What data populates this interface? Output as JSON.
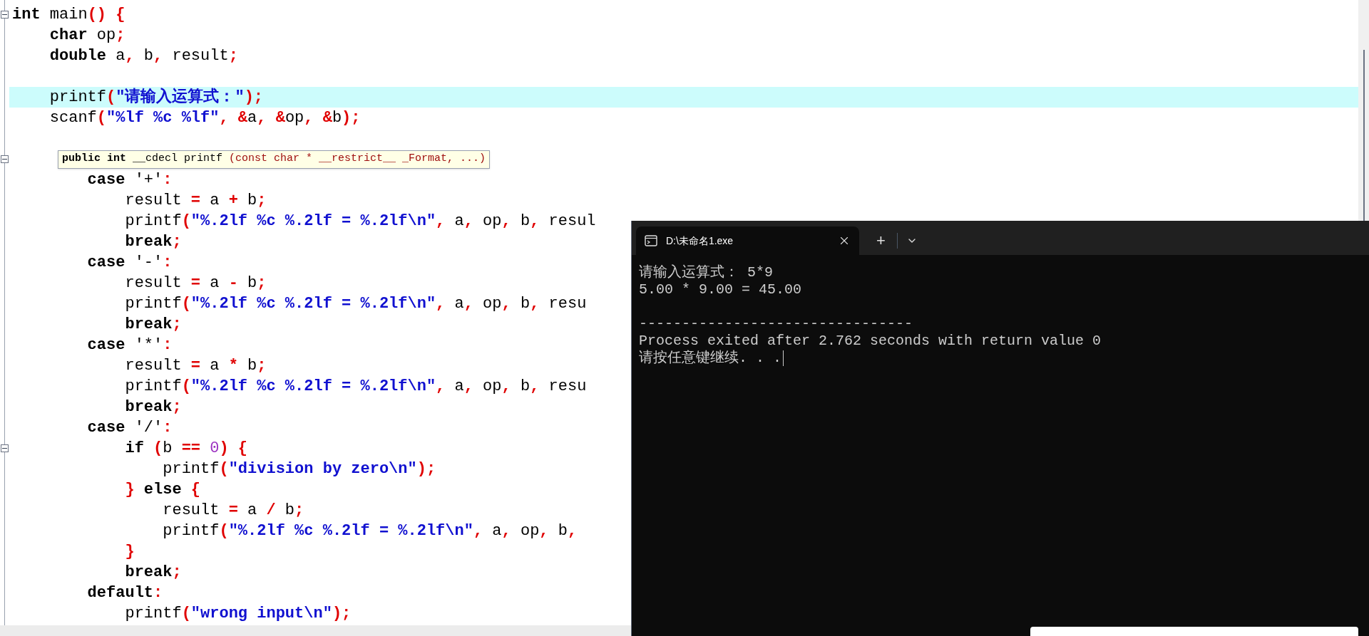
{
  "editor": {
    "lines": [
      {
        "kind": "code",
        "current": false,
        "fold": {
          "expanded": true
        },
        "tokens": [
          {
            "text": "int",
            "kind": "keyword"
          },
          {
            "text": " main",
            "kind": "plain"
          },
          {
            "text": "() {",
            "kind": "punct"
          }
        ]
      },
      {
        "kind": "code",
        "current": false,
        "tokens": [
          {
            "text": "    char",
            "kind": "keyword"
          },
          {
            "text": " op",
            "kind": "plain"
          },
          {
            "text": ";",
            "kind": "punct"
          }
        ]
      },
      {
        "kind": "code",
        "current": false,
        "tokens": [
          {
            "text": "    double",
            "kind": "keyword"
          },
          {
            "text": " a",
            "kind": "plain"
          },
          {
            "text": ",",
            "kind": "punct"
          },
          {
            "text": " b",
            "kind": "plain"
          },
          {
            "text": ",",
            "kind": "punct"
          },
          {
            "text": " result",
            "kind": "plain"
          },
          {
            "text": ";",
            "kind": "punct"
          }
        ]
      },
      {
        "kind": "blank"
      },
      {
        "kind": "code",
        "current": true,
        "tokens": [
          {
            "text": "    printf",
            "kind": "plain"
          },
          {
            "text": "(",
            "kind": "punct"
          },
          {
            "text": "\"请输入运算式：\"",
            "kind": "string"
          },
          {
            "text": ");",
            "kind": "punct"
          }
        ]
      },
      {
        "kind": "code",
        "current": false,
        "tokens": [
          {
            "text": "    scanf",
            "kind": "plain"
          },
          {
            "text": "(",
            "kind": "punct"
          },
          {
            "text": "\"%lf %c %lf\"",
            "kind": "string"
          },
          {
            "text": ",",
            "kind": "punct"
          },
          {
            "text": " &",
            "kind": "punct"
          },
          {
            "text": "a",
            "kind": "plain"
          },
          {
            "text": ",",
            "kind": "punct"
          },
          {
            "text": " &",
            "kind": "punct"
          },
          {
            "text": "op",
            "kind": "plain"
          },
          {
            "text": ",",
            "kind": "punct"
          },
          {
            "text": " &",
            "kind": "punct"
          },
          {
            "text": "b",
            "kind": "plain"
          },
          {
            "text": ");",
            "kind": "punct"
          }
        ]
      },
      {
        "kind": "blank"
      },
      {
        "kind": "tooltip",
        "fold": {
          "expanded": true
        },
        "tokens": [
          {
            "text": "public int",
            "kind": "keyword"
          },
          {
            "text": " __cdecl printf ",
            "kind": "plain"
          },
          {
            "text": "(const char * __restrict__ _Format, ...)",
            "kind": "param"
          }
        ]
      },
      {
        "kind": "code",
        "current": false,
        "tokens": [
          {
            "text": "        case",
            "kind": "keyword"
          },
          {
            "text": " '+'",
            "kind": "plain"
          },
          {
            "text": ":",
            "kind": "punct"
          }
        ]
      },
      {
        "kind": "code",
        "current": false,
        "tokens": [
          {
            "text": "            result",
            "kind": "plain"
          },
          {
            "text": " =",
            "kind": "punct"
          },
          {
            "text": " a",
            "kind": "plain"
          },
          {
            "text": " +",
            "kind": "punct"
          },
          {
            "text": " b",
            "kind": "plain"
          },
          {
            "text": ";",
            "kind": "punct"
          }
        ]
      },
      {
        "kind": "code",
        "current": false,
        "tokens": [
          {
            "text": "            printf",
            "kind": "plain"
          },
          {
            "text": "(",
            "kind": "punct"
          },
          {
            "text": "\"%.2lf %c %.2lf = %.2lf\\n\"",
            "kind": "string"
          },
          {
            "text": ",",
            "kind": "punct"
          },
          {
            "text": " a",
            "kind": "plain"
          },
          {
            "text": ",",
            "kind": "punct"
          },
          {
            "text": " op",
            "kind": "plain"
          },
          {
            "text": ",",
            "kind": "punct"
          },
          {
            "text": " b",
            "kind": "plain"
          },
          {
            "text": ",",
            "kind": "punct"
          },
          {
            "text": " resul",
            "kind": "plain"
          }
        ]
      },
      {
        "kind": "code",
        "current": false,
        "tokens": [
          {
            "text": "            break",
            "kind": "keyword"
          },
          {
            "text": ";",
            "kind": "punct"
          }
        ]
      },
      {
        "kind": "code",
        "current": false,
        "tokens": [
          {
            "text": "        case",
            "kind": "keyword"
          },
          {
            "text": " '-'",
            "kind": "plain"
          },
          {
            "text": ":",
            "kind": "punct"
          }
        ]
      },
      {
        "kind": "code",
        "current": false,
        "tokens": [
          {
            "text": "            result",
            "kind": "plain"
          },
          {
            "text": " =",
            "kind": "punct"
          },
          {
            "text": " a",
            "kind": "plain"
          },
          {
            "text": " -",
            "kind": "punct"
          },
          {
            "text": " b",
            "kind": "plain"
          },
          {
            "text": ";",
            "kind": "punct"
          }
        ]
      },
      {
        "kind": "code",
        "current": false,
        "tokens": [
          {
            "text": "            printf",
            "kind": "plain"
          },
          {
            "text": "(",
            "kind": "punct"
          },
          {
            "text": "\"%.2lf %c %.2lf = %.2lf\\n\"",
            "kind": "string"
          },
          {
            "text": ",",
            "kind": "punct"
          },
          {
            "text": " a",
            "kind": "plain"
          },
          {
            "text": ",",
            "kind": "punct"
          },
          {
            "text": " op",
            "kind": "plain"
          },
          {
            "text": ",",
            "kind": "punct"
          },
          {
            "text": " b",
            "kind": "plain"
          },
          {
            "text": ",",
            "kind": "punct"
          },
          {
            "text": " resu",
            "kind": "plain"
          }
        ]
      },
      {
        "kind": "code",
        "current": false,
        "tokens": [
          {
            "text": "            break",
            "kind": "keyword"
          },
          {
            "text": ";",
            "kind": "punct"
          }
        ]
      },
      {
        "kind": "code",
        "current": false,
        "tokens": [
          {
            "text": "        case",
            "kind": "keyword"
          },
          {
            "text": " '*'",
            "kind": "plain"
          },
          {
            "text": ":",
            "kind": "punct"
          }
        ]
      },
      {
        "kind": "code",
        "current": false,
        "tokens": [
          {
            "text": "            result",
            "kind": "plain"
          },
          {
            "text": " =",
            "kind": "punct"
          },
          {
            "text": " a",
            "kind": "plain"
          },
          {
            "text": " *",
            "kind": "punct"
          },
          {
            "text": " b",
            "kind": "plain"
          },
          {
            "text": ";",
            "kind": "punct"
          }
        ]
      },
      {
        "kind": "code",
        "current": false,
        "tokens": [
          {
            "text": "            printf",
            "kind": "plain"
          },
          {
            "text": "(",
            "kind": "punct"
          },
          {
            "text": "\"%.2lf %c %.2lf = %.2lf\\n\"",
            "kind": "string"
          },
          {
            "text": ",",
            "kind": "punct"
          },
          {
            "text": " a",
            "kind": "plain"
          },
          {
            "text": ",",
            "kind": "punct"
          },
          {
            "text": " op",
            "kind": "plain"
          },
          {
            "text": ",",
            "kind": "punct"
          },
          {
            "text": " b",
            "kind": "plain"
          },
          {
            "text": ",",
            "kind": "punct"
          },
          {
            "text": " resu",
            "kind": "plain"
          }
        ]
      },
      {
        "kind": "code",
        "current": false,
        "tokens": [
          {
            "text": "            break",
            "kind": "keyword"
          },
          {
            "text": ";",
            "kind": "punct"
          }
        ]
      },
      {
        "kind": "code",
        "current": false,
        "tokens": [
          {
            "text": "        case",
            "kind": "keyword"
          },
          {
            "text": " '/'",
            "kind": "plain"
          },
          {
            "text": ":",
            "kind": "punct"
          }
        ]
      },
      {
        "kind": "code",
        "current": false,
        "fold": {
          "expanded": true
        },
        "tokens": [
          {
            "text": "            if",
            "kind": "keyword"
          },
          {
            "text": " (",
            "kind": "punct"
          },
          {
            "text": "b",
            "kind": "plain"
          },
          {
            "text": " ==",
            "kind": "punct"
          },
          {
            "text": " 0",
            "kind": "number"
          },
          {
            "text": ")",
            "kind": "punct"
          },
          {
            "text": " {",
            "kind": "punct"
          }
        ]
      },
      {
        "kind": "code",
        "current": false,
        "tokens": [
          {
            "text": "                printf",
            "kind": "plain"
          },
          {
            "text": "(",
            "kind": "punct"
          },
          {
            "text": "\"division by zero\\n\"",
            "kind": "string"
          },
          {
            "text": ");",
            "kind": "punct"
          }
        ]
      },
      {
        "kind": "code",
        "current": false,
        "tokens": [
          {
            "text": "            }",
            "kind": "punct"
          },
          {
            "text": " else",
            "kind": "keyword"
          },
          {
            "text": " {",
            "kind": "punct"
          }
        ]
      },
      {
        "kind": "code",
        "current": false,
        "tokens": [
          {
            "text": "                result",
            "kind": "plain"
          },
          {
            "text": " =",
            "kind": "punct"
          },
          {
            "text": " a",
            "kind": "plain"
          },
          {
            "text": " /",
            "kind": "punct"
          },
          {
            "text": " b",
            "kind": "plain"
          },
          {
            "text": ";",
            "kind": "punct"
          }
        ]
      },
      {
        "kind": "code",
        "current": false,
        "tokens": [
          {
            "text": "                printf",
            "kind": "plain"
          },
          {
            "text": "(",
            "kind": "punct"
          },
          {
            "text": "\"%.2lf %c %.2lf = %.2lf\\n\"",
            "kind": "string"
          },
          {
            "text": ",",
            "kind": "punct"
          },
          {
            "text": " a",
            "kind": "plain"
          },
          {
            "text": ",",
            "kind": "punct"
          },
          {
            "text": " op",
            "kind": "plain"
          },
          {
            "text": ",",
            "kind": "punct"
          },
          {
            "text": " b",
            "kind": "plain"
          },
          {
            "text": ",",
            "kind": "punct"
          }
        ]
      },
      {
        "kind": "code",
        "current": false,
        "tokens": [
          {
            "text": "            }",
            "kind": "punct"
          }
        ]
      },
      {
        "kind": "code",
        "current": false,
        "tokens": [
          {
            "text": "            break",
            "kind": "keyword"
          },
          {
            "text": ";",
            "kind": "punct"
          }
        ]
      },
      {
        "kind": "code",
        "current": false,
        "tokens": [
          {
            "text": "        default",
            "kind": "keyword"
          },
          {
            "text": ":",
            "kind": "punct"
          }
        ]
      },
      {
        "kind": "code",
        "current": false,
        "tokens": [
          {
            "text": "            printf",
            "kind": "plain"
          },
          {
            "text": "(",
            "kind": "punct"
          },
          {
            "text": "\"wrong input\\n\"",
            "kind": "string"
          },
          {
            "text": ");",
            "kind": "punct"
          }
        ]
      }
    ]
  },
  "terminal": {
    "tab": {
      "title": "D:\\未命名1.exe",
      "selected": true
    },
    "new_tab": "+",
    "cursor": true,
    "lines": [
      {
        "kind": "text",
        "text": "请输入运算式： 5*9"
      },
      {
        "kind": "text",
        "text": "5.00 * 9.00 = 45.00"
      },
      {
        "kind": "blank"
      },
      {
        "kind": "text",
        "text": "--------------------------------"
      },
      {
        "kind": "text",
        "text": "Process exited after 2.762 seconds with return value 0"
      },
      {
        "kind": "text",
        "text": "请按任意键继续. . ."
      }
    ]
  }
}
